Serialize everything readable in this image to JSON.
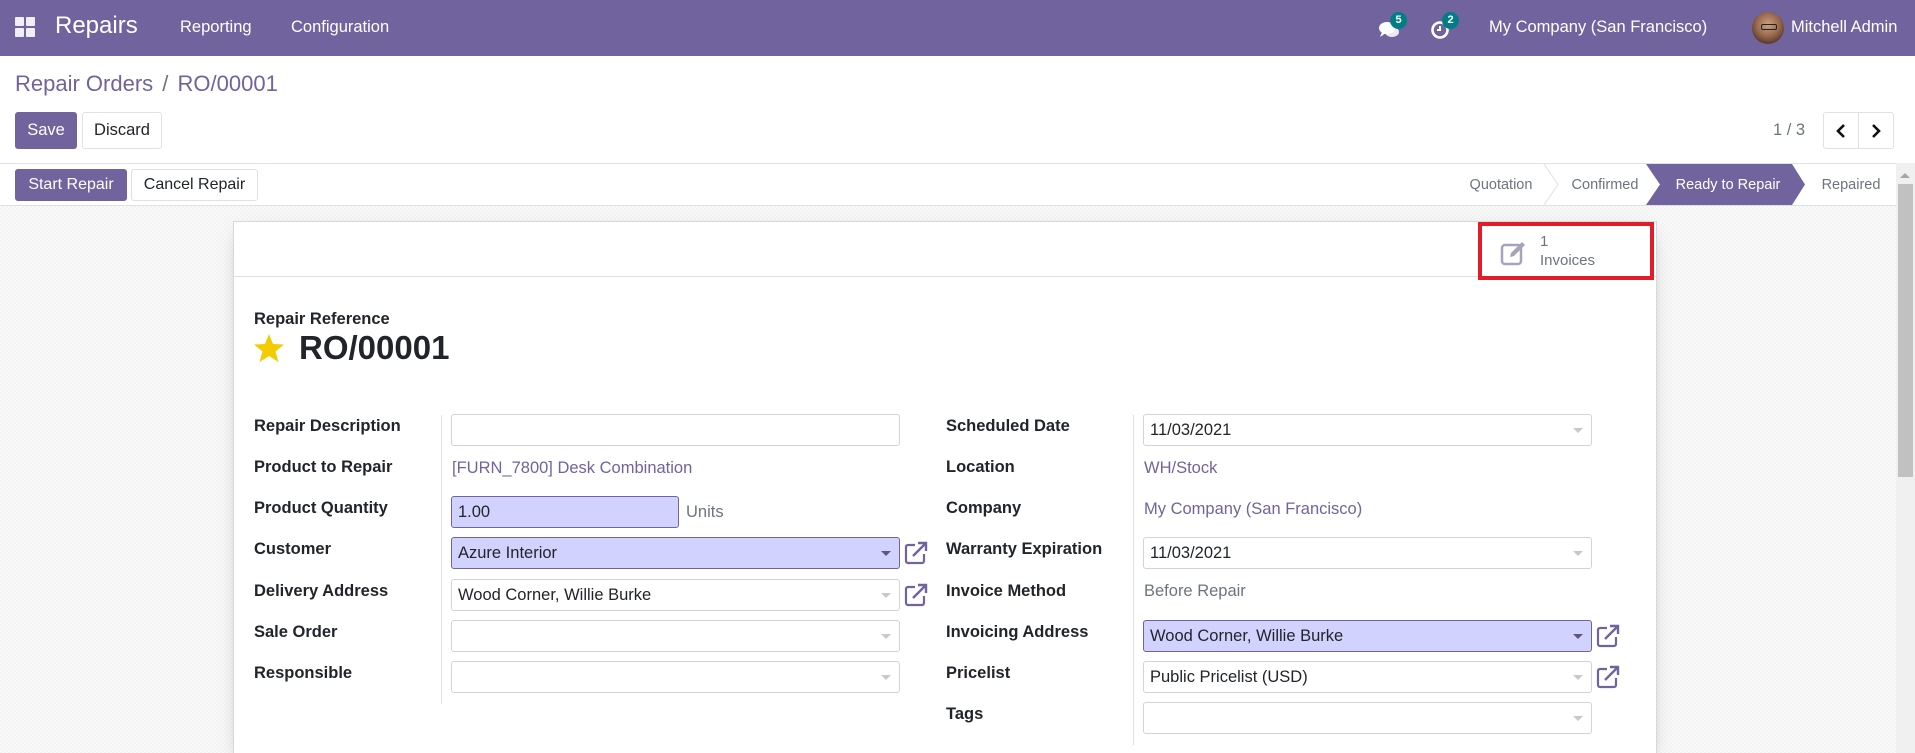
{
  "navbar": {
    "app_name": "Repairs",
    "menus": [
      "Reporting",
      "Configuration"
    ],
    "messages_badge": "5",
    "activities_badge": "2",
    "company": "My Company (San Francisco)",
    "user": "Mitchell Admin"
  },
  "breadcrumb": {
    "parent": "Repair Orders",
    "separator": "/",
    "current": "RO/00001"
  },
  "control": {
    "save_label": "Save",
    "discard_label": "Discard",
    "pager": "1 / 3",
    "prev_icon": "chevron-left-icon",
    "next_icon": "chevron-right-icon"
  },
  "statusbar": {
    "buttons": [
      "Start Repair",
      "Cancel Repair"
    ],
    "stages": [
      {
        "label": "Quotation",
        "active": false
      },
      {
        "label": "Confirmed",
        "active": false
      },
      {
        "label": "Ready to Repair",
        "active": true
      },
      {
        "label": "Repaired",
        "active": false
      }
    ]
  },
  "smart_button": {
    "value": "1",
    "label": "Invoices",
    "icon": "pencil-square-icon",
    "highlight_color": "#e11d2a"
  },
  "form": {
    "ref_label": "Repair Reference",
    "ref_value": "RO/00001",
    "left": [
      {
        "label": "Repair Description",
        "value": "",
        "type": "input"
      },
      {
        "label": "Product to Repair",
        "value": "[FURN_7800] Desk Combination",
        "type": "link"
      },
      {
        "label": "Product Quantity",
        "value": "1.00",
        "unit": "Units",
        "type": "required-input"
      },
      {
        "label": "Customer",
        "value": "Azure Interior",
        "type": "required-select"
      },
      {
        "label": "Delivery Address",
        "value": "Wood Corner, Willie Burke",
        "type": "select"
      },
      {
        "label": "Sale Order",
        "value": "",
        "type": "select"
      },
      {
        "label": "Responsible",
        "value": "",
        "type": "select"
      }
    ],
    "right": [
      {
        "label": "Scheduled Date",
        "value": "11/03/2021",
        "type": "select"
      },
      {
        "label": "Location",
        "value": "WH/Stock",
        "type": "link"
      },
      {
        "label": "Company",
        "value": "My Company (San Francisco)",
        "type": "link"
      },
      {
        "label": "Warranty Expiration",
        "value": "11/03/2021",
        "type": "select"
      },
      {
        "label": "Invoice Method",
        "value": "Before Repair",
        "type": "text"
      },
      {
        "label": "Invoicing Address",
        "value": "Wood Corner, Willie Burke",
        "type": "required-select"
      },
      {
        "label": "Pricelist",
        "value": "Public Pricelist (USD)",
        "type": "select"
      },
      {
        "label": "Tags",
        "value": "",
        "type": "select"
      }
    ]
  },
  "colors": {
    "brand": "#71639e",
    "required_bg": "#d2d2ff",
    "badge": "#017e84"
  }
}
